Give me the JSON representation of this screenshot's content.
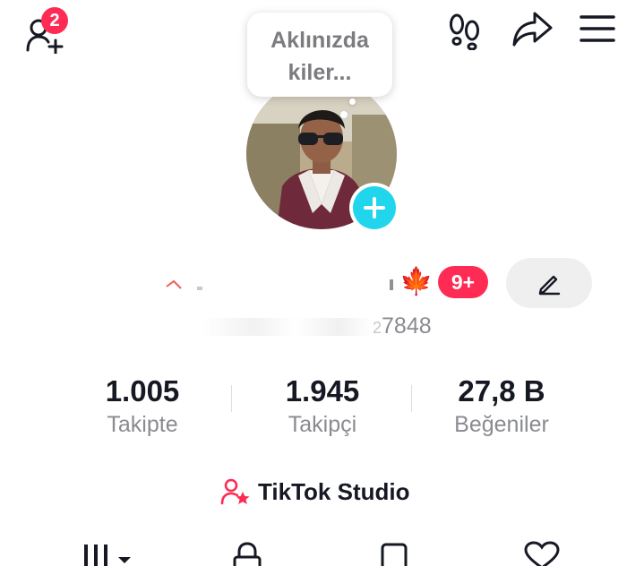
{
  "header": {
    "friend_request_count": "2",
    "icons": [
      "add-friend-icon",
      "footprints-icon",
      "share-icon",
      "menu-icon"
    ]
  },
  "bubble": {
    "text_line1": "Aklınızda",
    "text_line2": "kiler..."
  },
  "profile": {
    "notification_badge": "9+",
    "handle_suffix": "7848",
    "handle_fragment": "2"
  },
  "stats": [
    {
      "value": "1.005",
      "label": "Takipte"
    },
    {
      "value": "1.945",
      "label": "Takipçi"
    },
    {
      "value": "27,8 B",
      "label": "Beğeniler"
    }
  ],
  "studio": {
    "label": "TikTok Studio"
  },
  "tabs": [
    "videos-grid-icon",
    "lock-icon",
    "repost-icon",
    "heart-icon"
  ],
  "colors": {
    "accent_red": "#fe2c55",
    "accent_cyan": "#20d5ec",
    "text_primary": "#161823",
    "text_secondary": "#8a8b91"
  }
}
